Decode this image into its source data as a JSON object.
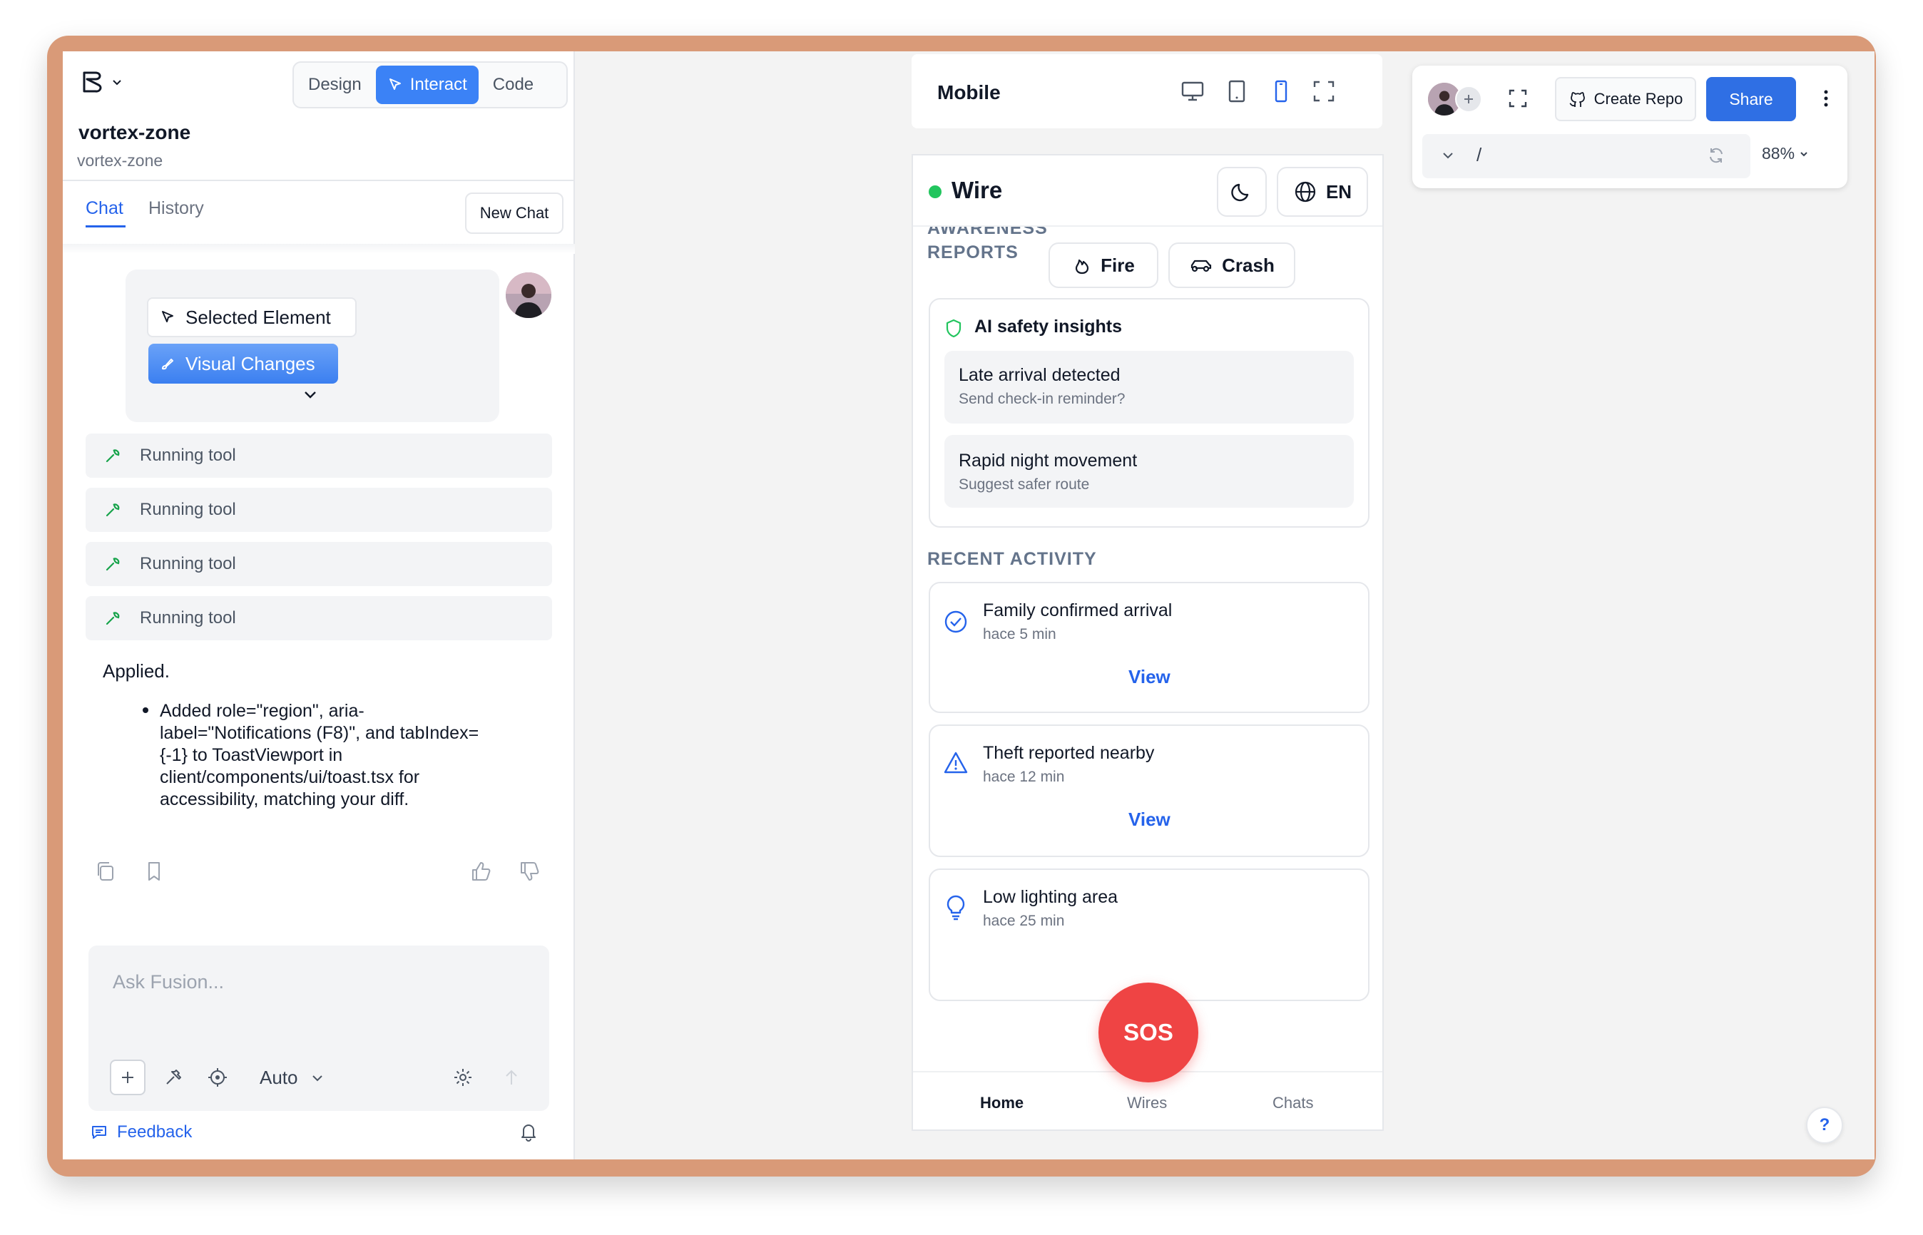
{
  "editor": {
    "modes": [
      "Design",
      "Interact",
      "Code"
    ],
    "active_mode": "Interact",
    "project_name": "vortex-zone",
    "project_sub": "vortex-zone",
    "tabs": {
      "chat": "Chat",
      "history": "History"
    },
    "new_chat": "New Chat"
  },
  "chat": {
    "chip_selected": "Selected Element",
    "chip_visual": "Visual Changes",
    "tools": [
      "Running tool",
      "Running tool",
      "Running tool",
      "Running tool"
    ],
    "applied": "Applied.",
    "bullet_lines": [
      "Added role=\"region\", aria-",
      "label=\"Notifications (F8)\", and tabIndex=",
      "{-1} to ToastViewport in",
      "client/components/ui/toast.tsx for",
      "accessibility, matching your diff."
    ],
    "input_placeholder": "Ask Fusion...",
    "mode_select": "Auto",
    "feedback": "Feedback"
  },
  "preview": {
    "device_label": "Mobile",
    "repo_button": "Create Repo",
    "share_button": "Share",
    "path": "/",
    "zoom": "88%",
    "help": "?"
  },
  "app": {
    "brand": "Wire",
    "lang": "EN",
    "section_reports_cut": "AWARENESS",
    "section_reports": "REPORTS",
    "chips": [
      "Fire",
      "Crash"
    ],
    "insights_title": "AI safety insights",
    "insights": [
      {
        "title": "Late arrival detected",
        "sub": "Send check-in reminder?"
      },
      {
        "title": "Rapid night movement",
        "sub": "Suggest safer route"
      }
    ],
    "recent_title": "RECENT ACTIVITY",
    "activity": [
      {
        "title": "Family confirmed arrival",
        "time": "hace 5 min",
        "action": "View",
        "icon": "check-circle-icon"
      },
      {
        "title": "Theft reported nearby",
        "time": "hace 12 min",
        "action": "View",
        "icon": "warning-icon"
      },
      {
        "title": "Low lighting area",
        "time": "hace 25 min",
        "icon": "lightbulb-icon"
      }
    ],
    "sos": "SOS",
    "nav": [
      "Home",
      "Wires",
      "Chats"
    ],
    "accent": "#2563eb",
    "sos_color": "#ef4444",
    "status_dot": "#22c55e"
  }
}
